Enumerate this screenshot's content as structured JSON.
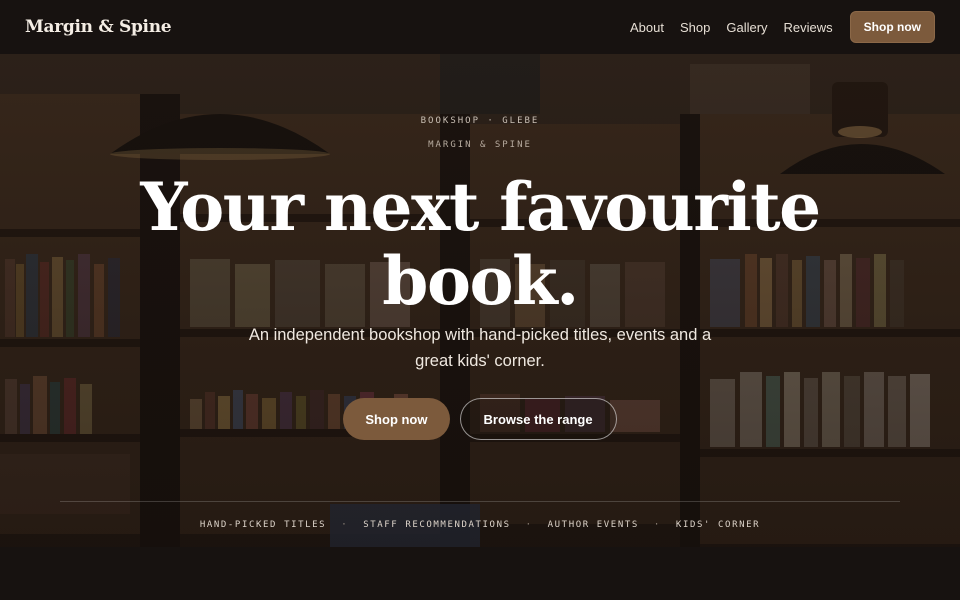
{
  "nav": {
    "brand": "Margin & Spine",
    "links": [
      "About",
      "Shop",
      "Gallery",
      "Reviews"
    ],
    "cta": "Shop now"
  },
  "hero": {
    "eyebrow": "BOOKSHOP · GLEBE",
    "eyebrow2": "MARGIN & SPINE",
    "headline_line1": "Your next favourite",
    "headline_line2": "book.",
    "subtitle": "An independent bookshop with hand-picked titles, events and a great kids' corner.",
    "primary_button": "Shop now",
    "secondary_button": "Browse the range",
    "features": [
      "HAND-PICKED TITLES",
      "STAFF RECOMMENDATIONS",
      "AUTHOR EVENTS",
      "KIDS' CORNER"
    ],
    "feature_separator": "·"
  },
  "colors": {
    "background": "#171210",
    "accent": "#7c5a3c",
    "text": "#ffffff"
  }
}
